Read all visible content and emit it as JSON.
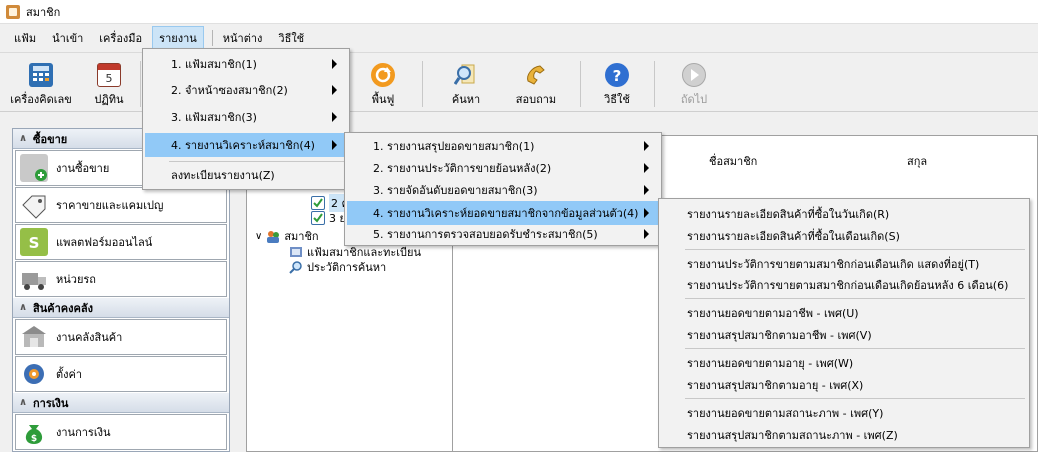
{
  "window": {
    "title": "สมาชิก"
  },
  "menubar": {
    "items": [
      "แฟ้ม",
      "นำเข้า",
      "เครื่องมือ",
      "รายงาน",
      "หน้าต่าง",
      "วิธีใช้"
    ],
    "active_index": 3
  },
  "toolbar": {
    "buttons": [
      {
        "label": "เครื่องคิดเลข",
        "icon": "calculator-icon"
      },
      {
        "label": "ปฏิทิน",
        "icon": "calendar-icon"
      },
      {
        "label": "พื้นฟู",
        "icon": "restore-icon"
      },
      {
        "label": "ค้นหา",
        "icon": "search-icon"
      },
      {
        "label": "สอบถาม",
        "icon": "phone-icon"
      },
      {
        "label": "วิธีใช้",
        "icon": "help-icon"
      },
      {
        "label": "ถัดไป",
        "icon": "next-icon"
      }
    ]
  },
  "leftpanel": {
    "sections": [
      {
        "title": "ซื้อขาย",
        "items": [
          {
            "label": "งานซื้อขาย",
            "icon": "sales-doc-icon"
          },
          {
            "label": "ราคาขายและแคมเปญ",
            "icon": "price-tag-icon"
          },
          {
            "label": "แพลตฟอร์มออนไลน์",
            "icon": "shopping-bag-icon"
          },
          {
            "label": "หน่วยรถ",
            "icon": "truck-icon"
          }
        ]
      },
      {
        "title": "สินค้าคงคลัง",
        "items": [
          {
            "label": "งานคลังสินค้า",
            "icon": "warehouse-icon"
          },
          {
            "label": "ตั้งค่า",
            "icon": "settings-icon"
          }
        ]
      },
      {
        "title": "การเงิน",
        "items": [
          {
            "label": "งานการเงิน",
            "icon": "money-bag-icon"
          }
        ]
      }
    ]
  },
  "tree": {
    "rows": [
      {
        "label": "2 ค"
      },
      {
        "label": "3 ย"
      },
      {
        "label": "สมาชิก"
      },
      {
        "label": "แฟ้มสมาชิกและทะเบียน"
      },
      {
        "label": "ประวัติการค้นหา"
      }
    ]
  },
  "grid": {
    "columns": [
      "ชื่อสมาชิก",
      "สกุล"
    ]
  },
  "report_menu": {
    "items": [
      {
        "label": "1. แฟ้มสมาชิก(1)",
        "submenu": true
      },
      {
        "label": "2. จำหน้าซองสมาชิก(2)",
        "submenu": true
      },
      {
        "label": "3. แฟ้มสมาชิก(3)",
        "submenu": true
      },
      {
        "label": "4. รายงานวิเคราะห์สมาชิก(4)",
        "submenu": true,
        "highlighted": true
      },
      {
        "label": "ลงทะเบียนรายงาน(Z)",
        "submenu": false
      }
    ]
  },
  "analysis_menu": {
    "items": [
      {
        "label": "1. รายงานสรุปยอดขายสมาชิก(1)",
        "submenu": true
      },
      {
        "label": "2. รายงานประวัติการขายย้อนหลัง(2)",
        "submenu": true
      },
      {
        "label": "3. รายจัดอันดับยอดขายสมาชิก(3)",
        "submenu": true
      },
      {
        "label": "4. รายงานวิเคราะห์ยอดขายสมาชิกจากข้อมูลส่วนตัว(4)",
        "submenu": true,
        "highlighted": true
      },
      {
        "label": "5. รายงานการตรวจสอบยอดรับชำระสมาชิก(5)",
        "submenu": true
      }
    ]
  },
  "personal_menu": {
    "items": [
      {
        "label": "รายงานรายละเอียดสินค้าที่ซื้อในวันเกิด(R)"
      },
      {
        "label": "รายงานรายละเอียดสินค้าที่ซื้อในเดือนเกิด(S)"
      },
      {
        "label": "รายงานประวัติการขายตามสมาชิกก่อนเดือนเกิด แสดงที่อยู่(T)"
      },
      {
        "label": "รายงานประวัติการขายตามสมาชิกก่อนเดือนเกิดย้อนหลัง 6 เดือน(6)"
      },
      {
        "label": "รายงานยอดขายตามอาชีพ - เพศ(U)"
      },
      {
        "label": "รายงานสรุปสมาชิกตามอาชีพ - เพศ(V)"
      },
      {
        "label": "รายงานยอดขายตามอายุ - เพศ(W)"
      },
      {
        "label": "รายงานสรุปสมาชิกตามอายุ - เพศ(X)"
      },
      {
        "label": "รายงานยอดขายตามสถานะภาพ - เพศ(Y)"
      },
      {
        "label": "รายงานสรุปสมาชิกตามสถานะภาพ - เพศ(Z)"
      }
    ]
  }
}
